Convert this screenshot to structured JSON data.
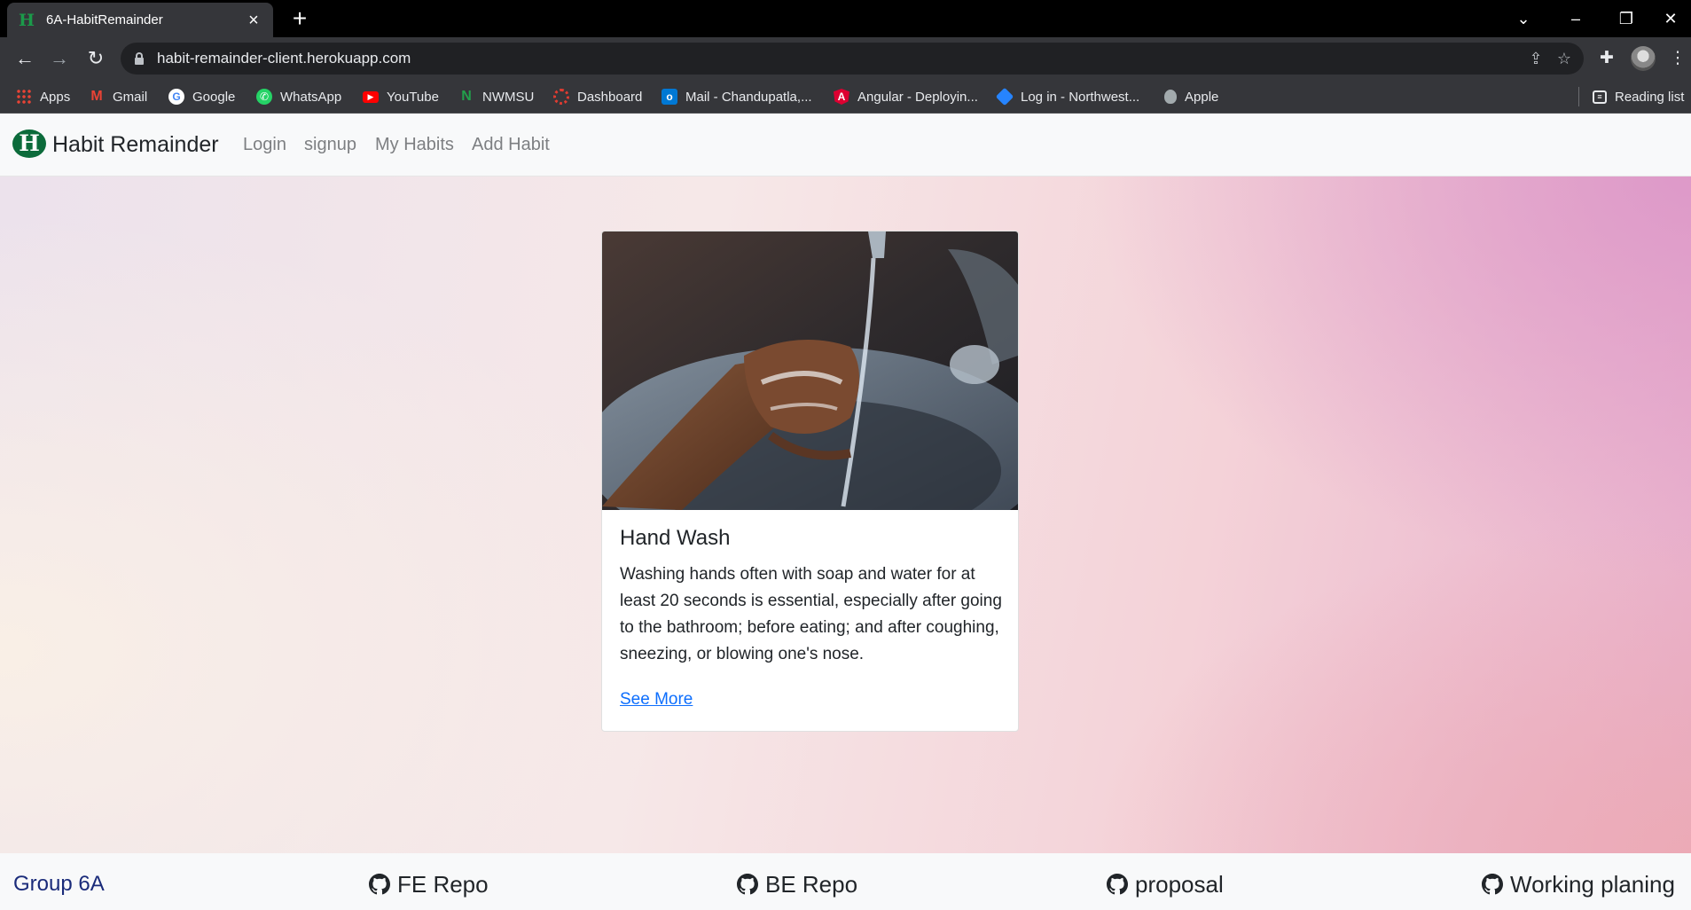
{
  "browser": {
    "tab_title": "6A-HabitRemainder",
    "tab_favicon_letter": "H",
    "new_tab": "+",
    "url": "habit-remainder-client.herokuapp.com",
    "reading_list": "Reading list",
    "bookmarks": [
      {
        "label": "Apps",
        "icon": "apps-grid-icon",
        "color": "#ea4335"
      },
      {
        "label": "Gmail",
        "icon": "gmail-icon",
        "color": "#ea4335"
      },
      {
        "label": "Google",
        "icon": "google-icon",
        "color": "#4285f4"
      },
      {
        "label": "WhatsApp",
        "icon": "whatsapp-icon",
        "color": "#25d366"
      },
      {
        "label": "YouTube",
        "icon": "youtube-icon",
        "color": "#ff0000"
      },
      {
        "label": "NWMSU",
        "icon": "nwmsu-icon",
        "color": "#006a31"
      },
      {
        "label": "Dashboard",
        "icon": "dashboard-icon",
        "color": "#e03c31"
      },
      {
        "label": "Mail - Chandupatla,...",
        "icon": "outlook-icon",
        "color": "#0078d4"
      },
      {
        "label": "Angular - Deployin...",
        "icon": "angular-icon",
        "color": "#dd0031"
      },
      {
        "label": "Log in - Northwest...",
        "icon": "jira-icon",
        "color": "#2684ff"
      },
      {
        "label": "Apple",
        "icon": "apple-icon",
        "color": "#a2aaad"
      }
    ]
  },
  "nav": {
    "logo_letter": "H",
    "brand": "Habit Remainder",
    "links": [
      "Login",
      "signup",
      "My Habits",
      "Add Habit"
    ]
  },
  "card": {
    "title": "Hand Wash",
    "text": "Washing hands often with soap and water for at least 20 seconds is essential, especially after going to the bathroom; before eating; and after coughing, sneezing, or blowing one's nose.",
    "link": "See More"
  },
  "footer": {
    "group": "Group 6A",
    "links": [
      "FE Repo",
      "BE Repo",
      "proposal",
      "Working planing"
    ]
  }
}
